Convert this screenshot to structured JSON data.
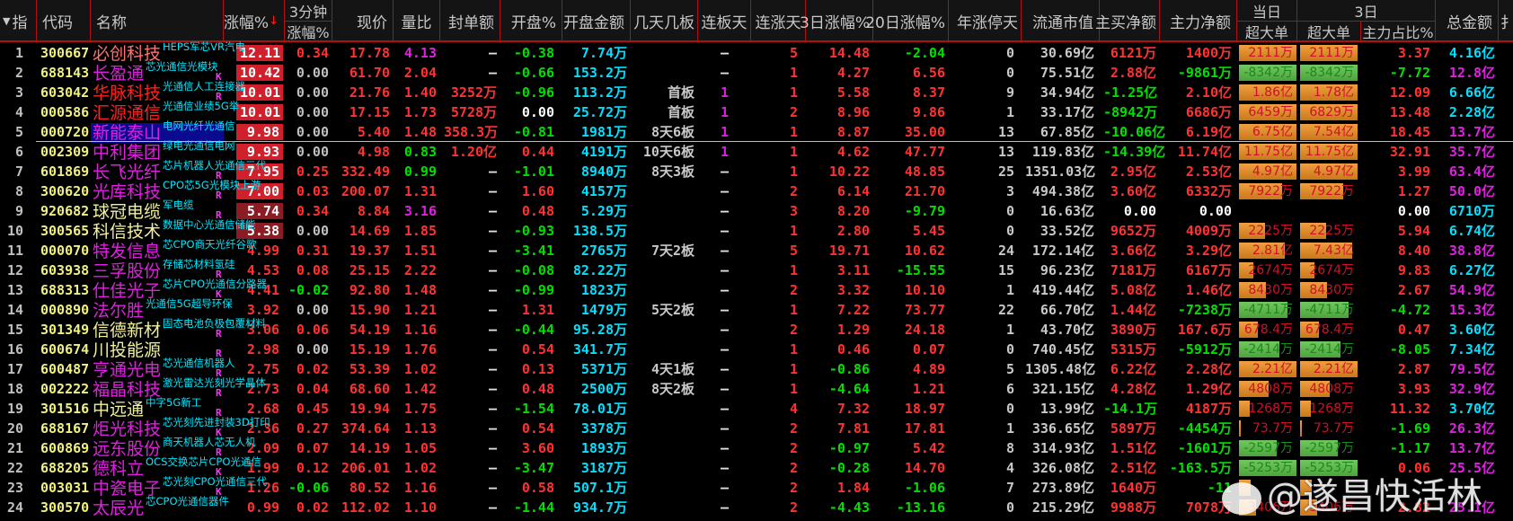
{
  "header": {
    "idx": "指",
    "sort_icon": "▼",
    "code": "代码",
    "name": "名称",
    "chg": "涨幅%",
    "sort_arrow": "↓",
    "min3_top": "3分钟",
    "min3_bot": "涨幅%",
    "price": "现价",
    "vr": "量比",
    "seal": "封单额",
    "open": "开盘%",
    "openAmt": "开盘金额",
    "boards": "几天几板",
    "lbt": "连板天",
    "lzt": "连涨天",
    "d3": "3日涨幅%",
    "d20": "20日涨幅%",
    "yzt": "年涨停天",
    "mcap": "流通市值",
    "zmj": "主买净额",
    "zljl": "主力净额",
    "today": "当日",
    "cdd": "超大单",
    "day3": "3日",
    "cdd3": "超大单",
    "zlzb": "主力占比%",
    "total": "总金额",
    "more": "扌"
  },
  "colors": {
    "up": "#ff3232",
    "down": "#00e000",
    "cyan": "#00e0ff",
    "magenta": "#e020e0",
    "code": "#f0f080",
    "orange": "#e08a28",
    "green_bar": "#5cb84a"
  },
  "rows": [
    {
      "idx": "1",
      "code": "300667",
      "name": "必创科技",
      "nc": "#ff7070",
      "tag": "HEPS军芯VR汽电",
      "mk": "",
      "chg": "12.11",
      "m3": "0.34",
      "price": "17.78",
      "vr": "4.13",
      "seal": "–",
      "open": "-0.38",
      "oa": "7.74万",
      "boards": "",
      "lbt": "–",
      "lzt": "5",
      "d3": "14.48",
      "d20": "-2.04",
      "yzt": "0",
      "mcap": "30.69亿",
      "zmj": "6121万",
      "zljl": "1400万",
      "cdd": "2111万",
      "cf": 1,
      "cdd3": "2111万",
      "cf3": 1,
      "zlzb": "3.37",
      "total": "4.16亿",
      "tc": "#00e0ff"
    },
    {
      "idx": "2",
      "code": "688143",
      "name": "长盈通",
      "nc": "#e020e0",
      "tag": "芯光通信光模块",
      "mk": "K",
      "chg": "10.42",
      "m3": "0.00",
      "price": "61.70",
      "vr": "2.04",
      "seal": "–",
      "open": "-0.66",
      "oa": "153.2万",
      "boards": "",
      "lbt": "–",
      "lzt": "1",
      "d3": "4.27",
      "d20": "6.56",
      "yzt": "0",
      "mcap": "75.51亿",
      "zmj": "2.88亿",
      "zljl": "-9861万",
      "cdd": "-8342万",
      "cf": 1,
      "cdd3": "-8342万",
      "cf3": 1,
      "zlzb": "-7.72",
      "total": "12.8亿",
      "tc": "#e020e0"
    },
    {
      "idx": "3",
      "code": "603042",
      "name": "华脉科技",
      "nc": "#ff2020",
      "tag": "光通信人工连接器",
      "mk": "R",
      "chg": "10.01",
      "m3": "0.00",
      "price": "21.76",
      "vr": "1.40",
      "seal": "3252万",
      "open": "-0.96",
      "oa": "113.2万",
      "boards": "首板",
      "lbt": "1",
      "lzt": "1",
      "d3": "5.58",
      "d20": "8.37",
      "yzt": "9",
      "mcap": "34.94亿",
      "zmj": "-1.25亿",
      "zljl": "2.10亿",
      "cdd": "1.86亿",
      "cf": 1,
      "cdd3": "1.78亿",
      "cf3": 1,
      "zlzb": "12.09",
      "total": "6.66亿",
      "tc": "#00e0ff"
    },
    {
      "idx": "4",
      "code": "000586",
      "name": "汇源通信",
      "nc": "#ff2020",
      "tag": "光通信业绩5G举",
      "mk": "",
      "chg": "10.01",
      "m3": "0.00",
      "price": "17.15",
      "vr": "1.73",
      "seal": "5728万",
      "open": "0.00",
      "oa": "25.72万",
      "boards": "首板",
      "lbt": "1",
      "lzt": "2",
      "d3": "8.96",
      "d20": "9.86",
      "yzt": "1",
      "mcap": "33.17亿",
      "zmj": "-8942万",
      "zljl": "6686万",
      "cdd": "6459万",
      "cf": 1,
      "cdd3": "6829万",
      "cf3": 1,
      "zlzb": "13.48",
      "total": "2.28亿",
      "tc": "#00e0ff"
    },
    {
      "idx": "5",
      "code": "000720",
      "name": "新能泰山",
      "nc": "#e020e0",
      "tag": "电网光纤光通信",
      "mk": "",
      "chg": "9.98",
      "m3": "0.00",
      "price": "5.40",
      "vr": "1.48",
      "seal": "358.3万",
      "open": "-0.81",
      "oa": "1981万",
      "boards": "8天6板",
      "lbt": "1",
      "lzt": "1",
      "d3": "8.87",
      "d20": "35.00",
      "yzt": "13",
      "mcap": "67.85亿",
      "zmj": "-10.06亿",
      "zljl": "6.19亿",
      "cdd": "6.75亿",
      "cf": 1,
      "cdd3": "7.54亿",
      "cf3": 1,
      "zlzb": "18.45",
      "total": "13.7亿",
      "tc": "#e020e0",
      "sel": true
    },
    {
      "idx": "6",
      "code": "002309",
      "name": "中利集团",
      "nc": "#e020e0",
      "tag": "绿电光通信电网",
      "mk": "",
      "chg": "9.93",
      "m3": "0.00",
      "price": "4.98",
      "vr": "0.83",
      "seal": "1.20亿",
      "open": "0.44",
      "oa": "4191万",
      "boards": "10天6板",
      "lbt": "1",
      "lzt": "1",
      "d3": "4.62",
      "d20": "47.77",
      "yzt": "13",
      "mcap": "119.83亿",
      "zmj": "-14.39亿",
      "zljl": "11.74亿",
      "cdd": "11.75亿",
      "cf": 1,
      "cdd3": "11.75亿",
      "cf3": 1,
      "zlzb": "32.91",
      "total": "35.7亿",
      "tc": "#e020e0"
    },
    {
      "idx": "7",
      "code": "601869",
      "name": "长飞光纤",
      "nc": "#e020e0",
      "tag": "芯片机器人光通信三代",
      "mk": "R",
      "chg": "7.95",
      "m3": "0.25",
      "price": "332.49",
      "vr": "0.99",
      "seal": "–",
      "open": "-1.01",
      "oa": "8940万",
      "boards": "8天3板",
      "lbt": "–",
      "lzt": "1",
      "d3": "10.22",
      "d20": "48.85",
      "yzt": "25",
      "mcap": "1351.03亿",
      "zmj": "2.95亿",
      "zljl": "2.53亿",
      "cdd": "4.97亿",
      "cf": 1,
      "cdd3": "4.97亿",
      "cf3": 1,
      "zlzb": "3.99",
      "total": "63.4亿",
      "tc": "#e020e0"
    },
    {
      "idx": "8",
      "code": "300620",
      "name": "光库科技",
      "nc": "#e020e0",
      "tag": "CPO芯5G光模块上游",
      "mk": "R",
      "chg": "7.00",
      "m3": "0.03",
      "price": "200.07",
      "vr": "1.31",
      "seal": "–",
      "open": "1.60",
      "oa": "4157万",
      "boards": "",
      "lbt": "–",
      "lzt": "2",
      "d3": "6.14",
      "d20": "21.70",
      "yzt": "3",
      "mcap": "494.38亿",
      "zmj": "3.60亿",
      "zljl": "6332万",
      "cdd": "7922万",
      "cf": 0.75,
      "cdd3": "7922万",
      "cf3": 0.75,
      "zlzb": "1.27",
      "total": "50.0亿",
      "tc": "#e020e0"
    },
    {
      "idx": "9",
      "code": "920682",
      "name": "球冠电缆",
      "nc": "#f0f0a0",
      "tag": "军电缆",
      "mk": "R",
      "chg": "5.74",
      "m3": "0.34",
      "price": "8.84",
      "vr": "3.16",
      "seal": "–",
      "open": "0.48",
      "oa": "5.29万",
      "boards": "",
      "lbt": "–",
      "lzt": "3",
      "d3": "8.20",
      "d20": "-9.79",
      "yzt": "0",
      "mcap": "16.63亿",
      "zmj": "0.00",
      "zljl": "0.00",
      "cdd": "",
      "cf": 0,
      "cdd3": "",
      "cf3": 0,
      "zlzb": "0.00",
      "total": "6710万",
      "tc": "#00e0ff"
    },
    {
      "idx": "10",
      "code": "300565",
      "name": "科信技术",
      "nc": "#f0f0a0",
      "tag": "数据中心光通信储能",
      "mk": "",
      "chg": "5.38",
      "m3": "0.00",
      "price": "14.69",
      "vr": "1.85",
      "seal": "–",
      "open": "-0.93",
      "oa": "138.5万",
      "boards": "",
      "lbt": "–",
      "lzt": "1",
      "d3": "2.80",
      "d20": "5.45",
      "yzt": "0",
      "mcap": "33.52亿",
      "zmj": "9652万",
      "zljl": "4009万",
      "cdd": "2225万",
      "cf": 0.45,
      "cdd3": "2225万",
      "cf3": 0.45,
      "zlzb": "5.94",
      "total": "6.74亿",
      "tc": "#00e0ff"
    },
    {
      "idx": "11",
      "code": "000070",
      "name": "特发信息",
      "nc": "#e020e0",
      "tag": "芯CPO商天光纤谷歌",
      "mk": "",
      "chg": "4.99",
      "m3": "0.31",
      "price": "19.37",
      "vr": "1.51",
      "seal": "–",
      "open": "-3.41",
      "oa": "2765万",
      "boards": "7天2板",
      "lbt": "–",
      "lzt": "5",
      "d3": "19.71",
      "d20": "10.62",
      "yzt": "24",
      "mcap": "172.14亿",
      "zmj": "3.66亿",
      "zljl": "3.29亿",
      "cdd": "2.81亿",
      "cf": 0.8,
      "cdd3": "7.43亿",
      "cf3": 0.9,
      "zlzb": "8.40",
      "total": "38.8亿",
      "tc": "#e020e0"
    },
    {
      "idx": "12",
      "code": "603938",
      "name": "三孚股份",
      "nc": "#e020e0",
      "tag": "存储芯材料氢硅",
      "mk": "R",
      "chg": "4.53",
      "m3": "0.08",
      "price": "25.15",
      "vr": "2.22",
      "seal": "–",
      "open": "-0.08",
      "oa": "82.22万",
      "boards": "",
      "lbt": "–",
      "lzt": "1",
      "d3": "3.11",
      "d20": "-15.55",
      "yzt": "15",
      "mcap": "96.23亿",
      "zmj": "7181万",
      "zljl": "6167万",
      "cdd": "2674万",
      "cf": 0.25,
      "cdd3": "2674万",
      "cf3": 0.25,
      "zlzb": "9.83",
      "total": "6.27亿",
      "tc": "#00e0ff"
    },
    {
      "idx": "13",
      "code": "688313",
      "name": "仕佳光子",
      "nc": "#e020e0",
      "tag": "芯片CPO光通信分路器",
      "mk": "K",
      "chg": "4.41",
      "m3": "-0.02",
      "price": "92.80",
      "vr": "1.48",
      "seal": "–",
      "open": "-0.99",
      "oa": "1823万",
      "boards": "",
      "lbt": "–",
      "lzt": "2",
      "d3": "3.32",
      "d20": "10.10",
      "yzt": "1",
      "mcap": "419.44亿",
      "zmj": "5.08亿",
      "zljl": "1.46亿",
      "cdd": "8430万",
      "cf": 0.47,
      "cdd3": "8430万",
      "cf3": 0.47,
      "zlzb": "2.67",
      "total": "54.9亿",
      "tc": "#e020e0"
    },
    {
      "idx": "14",
      "code": "000890",
      "name": "法尔胜",
      "nc": "#e020e0",
      "tag": "光通信5G超导环保",
      "mk": "",
      "chg": "3.92",
      "m3": "0.00",
      "price": "15.90",
      "vr": "1.21",
      "seal": "–",
      "open": "1.31",
      "oa": "1479万",
      "boards": "5天2板",
      "lbt": "–",
      "lzt": "1",
      "d3": "7.22",
      "d20": "73.77",
      "yzt": "22",
      "mcap": "66.70亿",
      "zmj": "1.44亿",
      "zljl": "-7238万",
      "cdd": "-4711万",
      "cf": 0.85,
      "cdd3": "-4711万",
      "cf3": 0.85,
      "zlzb": "-4.72",
      "total": "15.3亿",
      "tc": "#e020e0"
    },
    {
      "idx": "15",
      "code": "301349",
      "name": "信德新材",
      "nc": "#f0f0a0",
      "tag": "固态电池负极包覆材料",
      "mk": "R",
      "chg": "3.06",
      "m3": "0.06",
      "price": "54.19",
      "vr": "1.16",
      "seal": "–",
      "open": "-0.44",
      "oa": "95.28万",
      "boards": "",
      "lbt": "–",
      "lzt": "2",
      "d3": "1.29",
      "d20": "24.18",
      "yzt": "1",
      "mcap": "43.70亿",
      "zmj": "3890万",
      "zljl": "167.6万",
      "cdd": "678.4万",
      "cf": 0.33,
      "cdd3": "678.4万",
      "cf3": 0.33,
      "zlzb": "0.47",
      "total": "3.60亿",
      "tc": "#00e0ff"
    },
    {
      "idx": "16",
      "code": "600674",
      "name": "川投能源",
      "nc": "#f0f0a0",
      "tag": "",
      "mk": "R",
      "chg": "2.98",
      "m3": "0.00",
      "price": "15.19",
      "vr": "1.76",
      "seal": "–",
      "open": "0.54",
      "oa": "341.7万",
      "boards": "",
      "lbt": "–",
      "lzt": "1",
      "d3": "0.46",
      "d20": "0.07",
      "yzt": "0",
      "mcap": "740.45亿",
      "zmj": "5315万",
      "zljl": "-5912万",
      "cdd": "-2414万",
      "cf": 0.7,
      "cdd3": "-2414万",
      "cf3": 0.7,
      "zlzb": "-8.05",
      "total": "7.34亿",
      "tc": "#00e0ff"
    },
    {
      "idx": "17",
      "code": "600487",
      "name": "亨通光电",
      "nc": "#e020e0",
      "tag": "芯光通信机器人",
      "mk": "R",
      "chg": "2.75",
      "m3": "0.02",
      "price": "53.39",
      "vr": "1.02",
      "seal": "–",
      "open": "0.13",
      "oa": "5371万",
      "boards": "4天1板",
      "lbt": "–",
      "lzt": "1",
      "d3": "-0.86",
      "d20": "4.89",
      "yzt": "5",
      "mcap": "1305.48亿",
      "zmj": "6.22亿",
      "zljl": "2.28亿",
      "cdd": "2.21亿",
      "cf": 1,
      "cdd3": "2.21亿",
      "cf3": 1,
      "zlzb": "2.87",
      "total": "79.5亿",
      "tc": "#e020e0"
    },
    {
      "idx": "18",
      "code": "002222",
      "name": "福晶科技",
      "nc": "#e020e0",
      "tag": "激光雷达光刻光学晶体",
      "mk": "R",
      "chg": "2.73",
      "m3": "0.04",
      "price": "68.60",
      "vr": "1.42",
      "seal": "–",
      "open": "0.48",
      "oa": "2500万",
      "boards": "8天2板",
      "lbt": "–",
      "lzt": "1",
      "d3": "-4.64",
      "d20": "1.21",
      "yzt": "6",
      "mcap": "321.15亿",
      "zmj": "4.28亿",
      "zljl": "1.29亿",
      "cdd": "4808万",
      "cf": 0.52,
      "cdd3": "4808万",
      "cf3": 0.52,
      "zlzb": "3.93",
      "total": "32.9亿",
      "tc": "#e020e0"
    },
    {
      "idx": "19",
      "code": "301516",
      "name": "中远通",
      "nc": "#f0f0a0",
      "tag": "中字5G新工",
      "mk": "R",
      "chg": "2.68",
      "m3": "0.45",
      "price": "19.94",
      "vr": "1.75",
      "seal": "–",
      "open": "-1.54",
      "oa": "78.01万",
      "boards": "",
      "lbt": "–",
      "lzt": "4",
      "d3": "7.32",
      "d20": "18.97",
      "yzt": "0",
      "mcap": "13.99亿",
      "zmj": "-14.1万",
      "zljl": "4187万",
      "cdd": "1268万",
      "cf": 0.18,
      "cdd3": "1268万",
      "cf3": 0.18,
      "zlzb": "11.32",
      "total": "3.70亿",
      "tc": "#00e0ff"
    },
    {
      "idx": "20",
      "code": "688167",
      "name": "炬光科技",
      "nc": "#e020e0",
      "tag": "芯光刻先进封装3D打印",
      "mk": "K",
      "chg": "2.36",
      "m3": "0.27",
      "price": "374.64",
      "vr": "1.13",
      "seal": "–",
      "open": "0.54",
      "oa": "3378万",
      "boards": "",
      "lbt": "–",
      "lzt": "2",
      "d3": "7.81",
      "d20": "17.81",
      "yzt": "1",
      "mcap": "336.65亿",
      "zmj": "5897万",
      "zljl": "-4454万",
      "cdd": "73.7万",
      "cf": 0.03,
      "cdd3": "73.7万",
      "cf3": 0.03,
      "zlzb": "-1.69",
      "total": "26.3亿",
      "tc": "#e020e0"
    },
    {
      "idx": "21",
      "code": "600869",
      "name": "远东股份",
      "nc": "#e020e0",
      "tag": "商天机器人芯无人机",
      "mk": "R",
      "chg": "2.09",
      "m3": "0.07",
      "price": "14.19",
      "vr": "1.05",
      "seal": "–",
      "open": "3.60",
      "oa": "1893万",
      "boards": "",
      "lbt": "–",
      "lzt": "2",
      "d3": "-0.97",
      "d20": "5.42",
      "yzt": "8",
      "mcap": "314.93亿",
      "zmj": "1.51亿",
      "zljl": "-1601万",
      "cdd": "-2597万",
      "cf": 0.65,
      "cdd3": "-2597万",
      "cf3": 0.65,
      "zlzb": "-1.17",
      "total": "13.7亿",
      "tc": "#e020e0"
    },
    {
      "idx": "22",
      "code": "688205",
      "name": "德科立",
      "nc": "#e020e0",
      "tag": "OCS交换芯片CPO光通信",
      "mk": "K",
      "chg": "1.99",
      "m3": "0.12",
      "price": "206.01",
      "vr": "1.02",
      "seal": "–",
      "open": "-3.47",
      "oa": "3187万",
      "boards": "",
      "lbt": "–",
      "lzt": "2",
      "d3": "-0.28",
      "d20": "14.70",
      "yzt": "4",
      "mcap": "326.08亿",
      "zmj": "2.51亿",
      "zljl": "-163.5万",
      "cdd": "-5253万",
      "cf": 1,
      "cdd3": "-5253万",
      "cf3": 1,
      "zlzb": "0.06",
      "total": "25.5亿",
      "tc": "#e020e0"
    },
    {
      "idx": "23",
      "code": "003031",
      "name": "中瓷电子",
      "nc": "#e020e0",
      "tag": "芯光刻CPO光通信三代",
      "mk": "K",
      "chg": "1.26",
      "m3": "-0.06",
      "price": "80.52",
      "vr": "1.16",
      "seal": "–",
      "open": "0.58",
      "oa": "507.1万",
      "boards": "",
      "lbt": "–",
      "lzt": "2",
      "d3": "1.84",
      "d20": "-1.06",
      "yzt": "7",
      "mcap": "273.89亿",
      "zmj": "1640万",
      "zljl": "-11",
      "cdd": "",
      "cf": 0.2,
      "cdd3": "",
      "cf3": 0.2,
      "zlzb": "",
      "total": "",
      "tc": "#00e0ff"
    },
    {
      "idx": "24",
      "code": "300570",
      "name": "太辰光",
      "nc": "#e020e0",
      "tag": "芯CPO光通信器件",
      "mk": "",
      "chg": "0.99",
      "m3": "0.02",
      "price": "112.02",
      "vr": "1.10",
      "seal": "–",
      "open": "-1.44",
      "oa": "934.7万",
      "boards": "",
      "lbt": "–",
      "lzt": "2",
      "d3": "-4.43",
      "d20": "-13.16",
      "yzt": "0",
      "mcap": "215.29亿",
      "zmj": "9988万",
      "zljl": "7078万",
      "cdd": "3406万",
      "cf": 0.3,
      "cdd3": "3406万",
      "cf3": 0.3,
      "zlzb": "2.82",
      "total": "25.1亿",
      "tc": "#e020e0"
    }
  ],
  "watermark": "@遂昌快活林"
}
